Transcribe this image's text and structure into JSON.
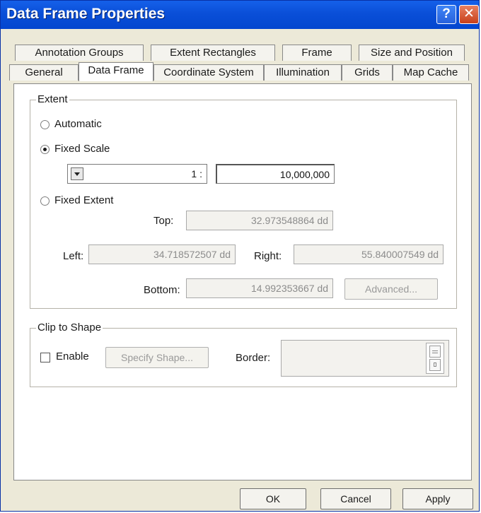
{
  "window": {
    "title": "Data Frame Properties",
    "help_label": "?",
    "close_label": "✕"
  },
  "tabs": {
    "row_back": [
      "Annotation Groups",
      "Extent Rectangles",
      "Frame",
      "Size and Position"
    ],
    "row_front": [
      "General",
      "Data Frame",
      "Coordinate System",
      "Illumination",
      "Grids",
      "Map Cache"
    ],
    "active": "Data Frame"
  },
  "extent": {
    "legend": "Extent",
    "automatic_label": "Automatic",
    "fixed_scale_label": "Fixed Scale",
    "fixed_extent_label": "Fixed Extent",
    "selected": "Fixed Scale",
    "scale_prefix": "1 :",
    "scale_value": "10,000,000",
    "top_label": "Top:",
    "top_value": "32.973548864 dd",
    "left_label": "Left:",
    "left_value": "34.718572507 dd",
    "right_label": "Right:",
    "right_value": "55.840007549 dd",
    "bottom_label": "Bottom:",
    "bottom_value": "14.992353667 dd",
    "advanced_label": "Advanced..."
  },
  "clip": {
    "legend": "Clip to Shape",
    "enable_label": "Enable",
    "enable_checked": false,
    "specify_shape_label": "Specify Shape...",
    "border_label": "Border:"
  },
  "buttons": {
    "ok": "OK",
    "cancel": "Cancel",
    "apply": "Apply"
  },
  "colors": {
    "titlebar": "#0a4fd8",
    "dialog_bg": "#ece9d8",
    "panel_bg": "#ffffff"
  }
}
